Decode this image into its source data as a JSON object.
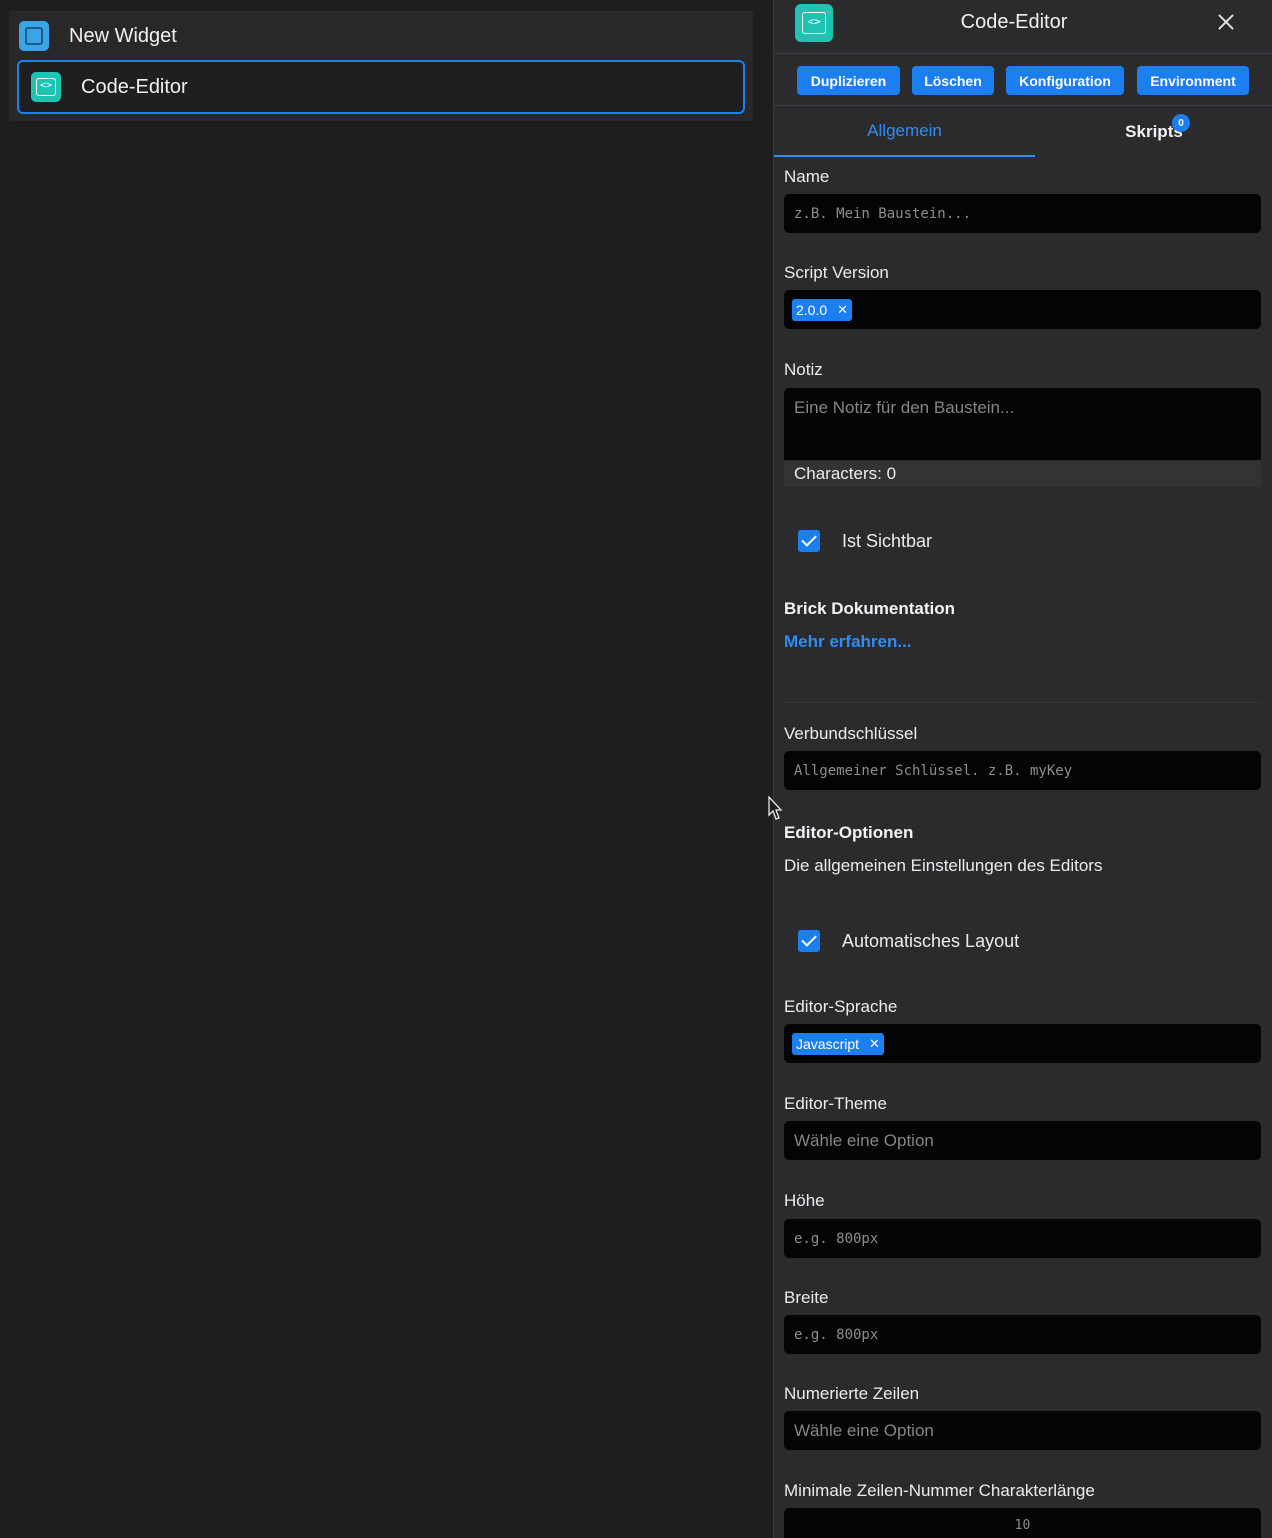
{
  "tree": {
    "items": [
      {
        "label": "New Widget",
        "icon": "widget-icon"
      },
      {
        "label": "Code-Editor",
        "icon": "code-editor-icon"
      }
    ]
  },
  "panel": {
    "title": "Code-Editor",
    "icon_glyph": "<>",
    "actions": [
      "Duplizieren",
      "Löschen",
      "Konfiguration",
      "Environment"
    ],
    "tabs": {
      "general": "Allgemein",
      "scripts": "Skripts",
      "scripts_badge": "0"
    }
  },
  "form": {
    "name": {
      "label": "Name",
      "placeholder": "z.B. Mein Baustein..."
    },
    "script_version": {
      "label": "Script Version",
      "tag": "2.0.0"
    },
    "note": {
      "label": "Notiz",
      "placeholder": "Eine Notiz für den Baustein...",
      "counter": "Characters: 0"
    },
    "visible": {
      "label": "Ist Sichtbar",
      "checked": true
    },
    "docs": {
      "title": "Brick Dokumentation",
      "link": "Mehr erfahren..."
    },
    "compound_key": {
      "label": "Verbundschlüssel",
      "placeholder": "Allgemeiner Schlüssel. z.B. myKey"
    },
    "editor_options": {
      "title": "Editor-Optionen",
      "description": "Die allgemeinen Einstellungen des Editors"
    },
    "auto_layout": {
      "label": "Automatisches Layout",
      "checked": true
    },
    "language": {
      "label": "Editor-Sprache",
      "tag": "Javascript"
    },
    "theme": {
      "label": "Editor-Theme",
      "placeholder": "Wähle eine Option"
    },
    "height": {
      "label": "Höhe",
      "placeholder": "e.g. 800px"
    },
    "width": {
      "label": "Breite",
      "placeholder": "e.g. 800px"
    },
    "line_numbers": {
      "label": "Numerierte Zeilen",
      "placeholder": "Wähle eine Option"
    },
    "min_line_chars": {
      "label": "Minimale Zeilen-Nummer Charakterlänge",
      "value": "10"
    }
  },
  "colors": {
    "accent": "#1b7ff2",
    "code_icon": "#1fc3b4",
    "widget_icon": "#39a4e8",
    "panel_bg": "#2b2b2e",
    "canvas_bg": "#1e1e20"
  }
}
